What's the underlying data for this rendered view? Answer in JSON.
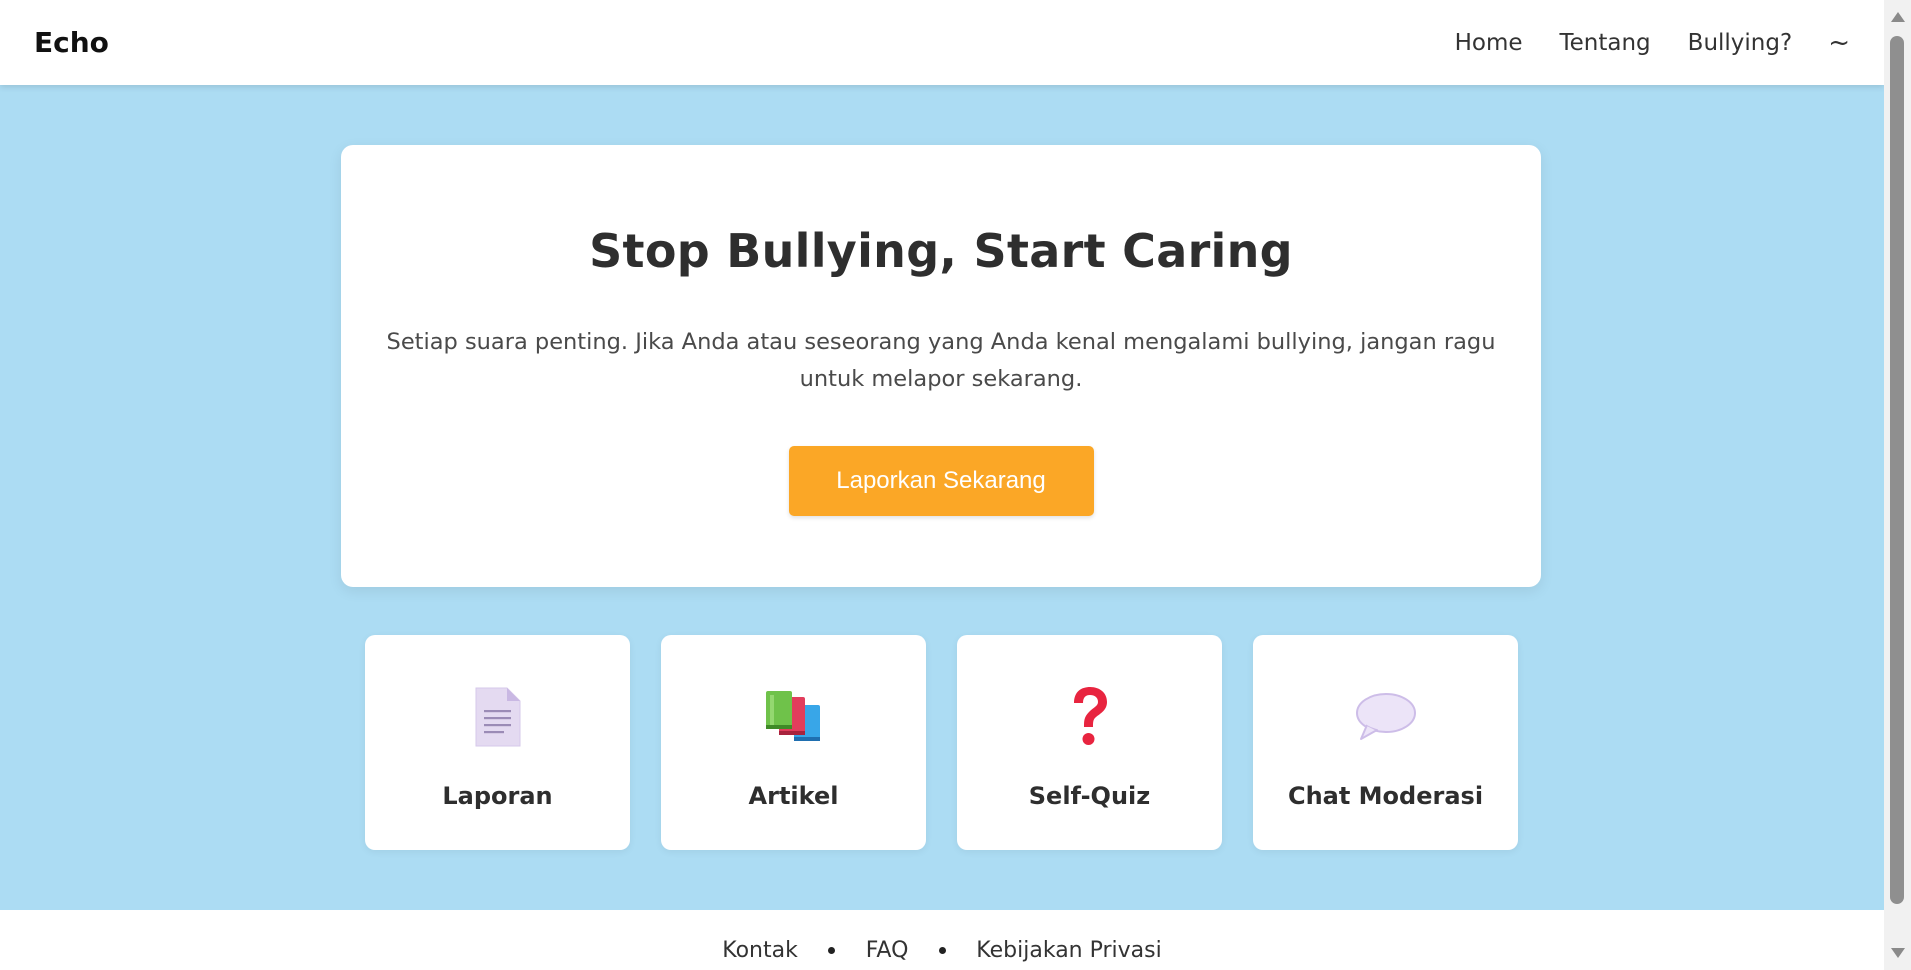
{
  "nav": {
    "brand": "Echo",
    "links": [
      "Home",
      "Tentang",
      "Bullying?"
    ],
    "theme_toggle_icon": "~"
  },
  "hero": {
    "title": "Stop Bullying, Start Caring",
    "text": "Setiap suara penting. Jika Anda atau seseorang yang Anda kenal mengalami bullying, jangan ragu untuk melapor sekarang.",
    "cta_label": "Laporkan Sekarang"
  },
  "cards": [
    {
      "label": "Laporan",
      "icon": "document-icon"
    },
    {
      "label": "Artikel",
      "icon": "books-icon"
    },
    {
      "label": "Self-Quiz",
      "icon": "question-mark-icon"
    },
    {
      "label": "Chat Moderasi",
      "icon": "speech-bubble-icon"
    }
  ],
  "footer": {
    "links": [
      "Kontak",
      "FAQ",
      "Kebijakan Privasi"
    ]
  },
  "colors": {
    "page_background": "#acdcf3",
    "cta": "#fba726",
    "card": "#ffffff"
  }
}
